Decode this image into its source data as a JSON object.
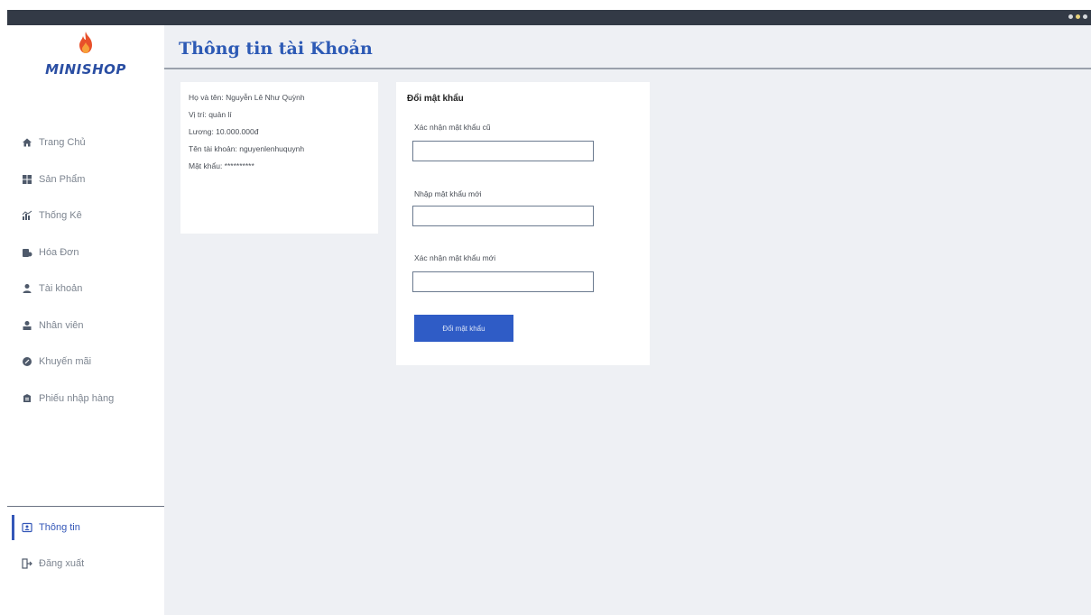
{
  "window": {
    "controls": [
      "minimize",
      "maximize",
      "close"
    ]
  },
  "sidebar": {
    "logo_text": "MINISHOP",
    "logo_icon": "flame-icon",
    "items": [
      {
        "label": "Trang Chủ",
        "icon": "home-icon"
      },
      {
        "label": "Sản Phẩm",
        "icon": "grid-icon"
      },
      {
        "label": "Thống Kê",
        "icon": "chart-icon"
      },
      {
        "label": "Hóa Đơn",
        "icon": "invoice-icon"
      },
      {
        "label": "Tài khoản",
        "icon": "user-icon"
      },
      {
        "label": "Nhân viên",
        "icon": "staff-icon"
      },
      {
        "label": "Khuyến mãi",
        "icon": "promo-icon"
      },
      {
        "label": "Phiếu nhập hàng",
        "icon": "receipt-icon"
      }
    ],
    "bottom": [
      {
        "label": "Thông tin",
        "icon": "id-card-icon",
        "active": true
      },
      {
        "label": "Đăng xuất",
        "icon": "logout-icon"
      }
    ]
  },
  "main": {
    "title": "Thông tin tài Khoản",
    "info": {
      "name": "Họ và tên: Nguyễn Lê Như Quỳnh",
      "position": "Vị trí: quản lí",
      "salary": "Lương: 10.000.000đ",
      "username": "Tên tài khoản: nguyenlenhuquynh",
      "password": "Mật khẩu: **********"
    },
    "change_password": {
      "title": "Đổi mật khẩu",
      "old_label": "Xác nhận mật khẩu cũ",
      "old_value": "",
      "new_label": "Nhập mật khẩu mới",
      "new_value": "",
      "confirm_label": "Xác nhận mật khẩu mới",
      "confirm_value": "",
      "button_label": "Đổi mật khẩu"
    }
  },
  "colors": {
    "accent": "#2f5cc6",
    "titlebar": "#333a46",
    "background": "#eef0f4"
  }
}
